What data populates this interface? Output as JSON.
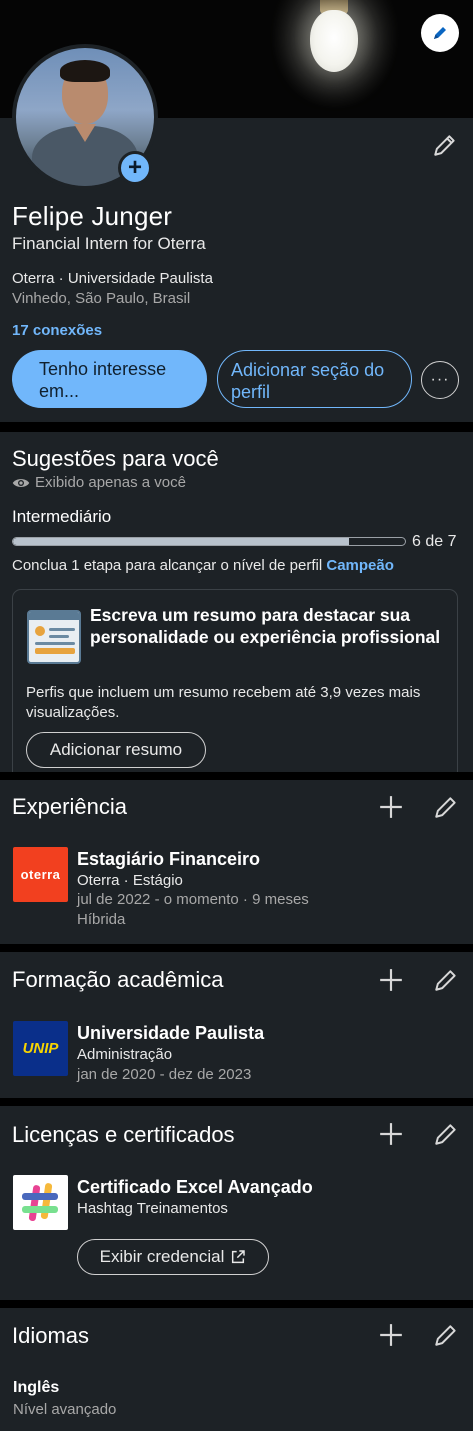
{
  "profile": {
    "name": "Felipe Junger",
    "headline": "Financial Intern for Oterra",
    "company_school": "Oterra · Universidade Paulista",
    "location": "Vinhedo, São Paulo, Brasil",
    "connections": "17 conexões",
    "primary_button": "Tenho interesse em...",
    "secondary_button": "Adicionar seção do perfil",
    "more_button": "···"
  },
  "suggestions": {
    "title": "Sugestões para você",
    "visibility": "Exibido apenas a você",
    "level": "Intermediário",
    "progress_value": 6,
    "progress_max": 7,
    "progress_label": "6 de 7",
    "finish_text": "Conclua 1 etapa para alcançar o nível de perfil ",
    "finish_highlight": "Campeão",
    "card_title": "Escreva um resumo para destacar sua personalidade ou experiência profissional",
    "card_text": "Perfis que incluem um resumo recebem até 3,9 vezes mais visualizações.",
    "card_button": "Adicionar resumo"
  },
  "experience": {
    "title": "Experiência",
    "logo_text": "oterra",
    "role": "Estagiário Financeiro",
    "company": "Oterra · Estágio",
    "period": "jul de 2022 - o momento · 9 meses",
    "mode": "Híbrida"
  },
  "education": {
    "title": "Formação acadêmica",
    "logo_text": "UNIP",
    "school": "Universidade Paulista",
    "course": "Administração",
    "period": "jan de 2020 - dez de 2023"
  },
  "licenses": {
    "title": "Licenças e certificados",
    "name": "Certificado Excel Avançado",
    "issuer": "Hashtag Treinamentos",
    "button": "Exibir credencial"
  },
  "languages": {
    "title": "Idiomas",
    "language": "Inglês",
    "level": "Nível avançado"
  },
  "colors": {
    "accent": "#71b7fb",
    "card_bg": "#1d2226",
    "oterra": "#f2401f",
    "unip": "#0a2f8a"
  }
}
